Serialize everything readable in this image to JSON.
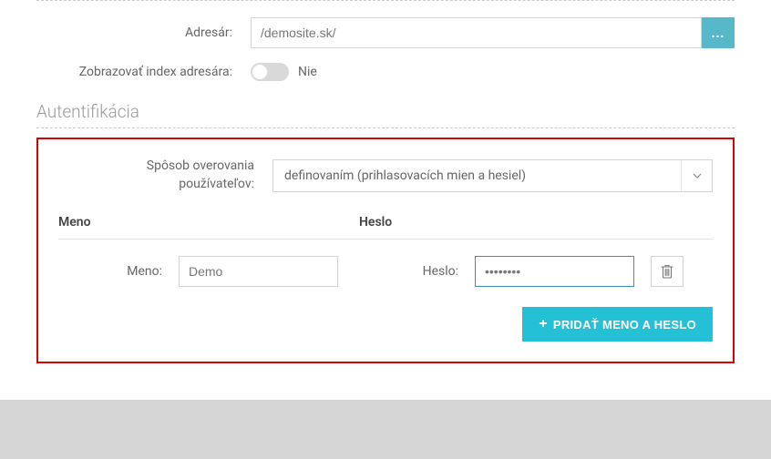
{
  "dir": {
    "label": "Adresár:",
    "value": "/demosite.sk/",
    "browse_btn": "..."
  },
  "index": {
    "label": "Zobrazovať index adresára:",
    "value": "Nie"
  },
  "auth": {
    "title": "Autentifikácia",
    "method_label1": "Spôsob overovania",
    "method_label2": "používateľov:",
    "method_value": "definovaním (prihlasovacích mien a hesiel)",
    "table": {
      "col1": "Meno",
      "col2": "Heslo"
    },
    "row": {
      "name_label": "Meno:",
      "name_value": "Demo",
      "pass_label": "Heslo:",
      "pass_value": "••••••••"
    },
    "add_btn": "PRIDAŤ MENO A HESLO"
  }
}
